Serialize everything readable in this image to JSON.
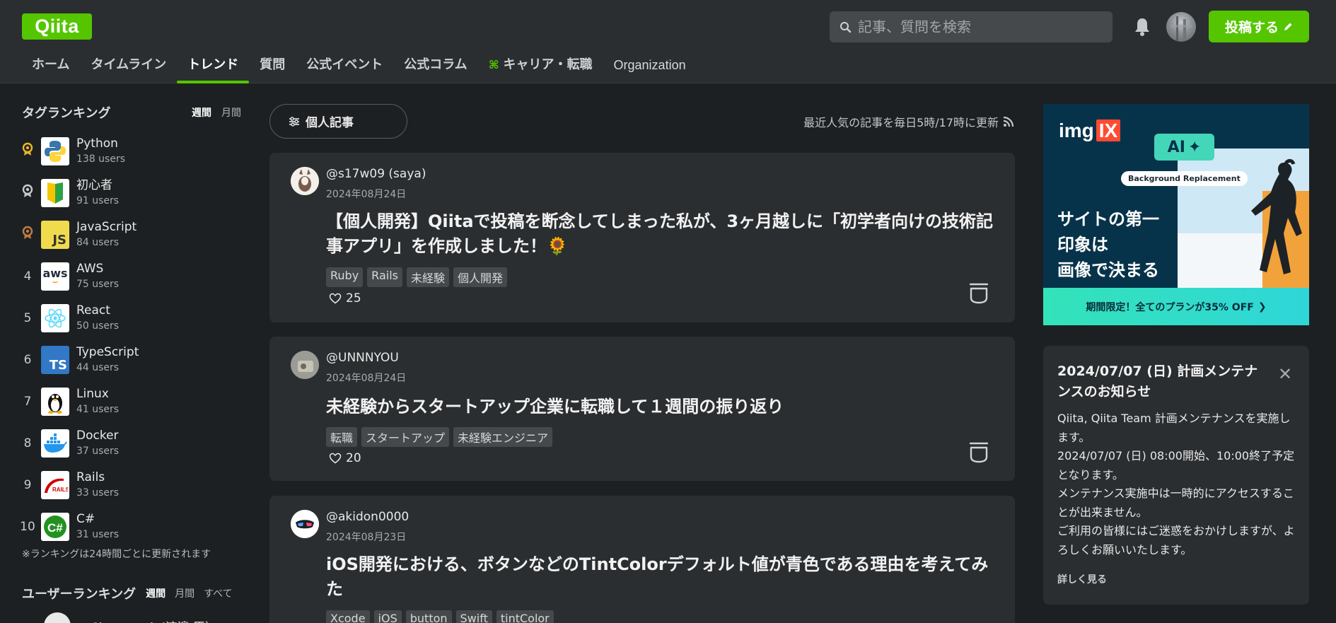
{
  "header": {
    "logo": "Qiita",
    "search_placeholder": "記事、質問を検索",
    "post_button": "投稿する"
  },
  "nav": [
    {
      "label": "ホーム",
      "active": false
    },
    {
      "label": "タイムライン",
      "active": false
    },
    {
      "label": "トレンド",
      "active": true
    },
    {
      "label": "質問",
      "active": false
    },
    {
      "label": "公式イベント",
      "active": false
    },
    {
      "label": "公式コラム",
      "active": false
    },
    {
      "label": "キャリア・転職",
      "active": false
    },
    {
      "label": "Organization",
      "active": false
    }
  ],
  "tag_ranking": {
    "title": "タグランキング",
    "toggle_weekly": "週間",
    "toggle_monthly": "月間",
    "items": [
      {
        "rank": "1",
        "name": "Python",
        "users": "138 users"
      },
      {
        "rank": "2",
        "name": "初心者",
        "users": "91 users"
      },
      {
        "rank": "3",
        "name": "JavaScript",
        "users": "84 users"
      },
      {
        "rank": "4",
        "name": "AWS",
        "users": "75 users"
      },
      {
        "rank": "5",
        "name": "React",
        "users": "50 users"
      },
      {
        "rank": "6",
        "name": "TypeScript",
        "users": "44 users"
      },
      {
        "rank": "7",
        "name": "Linux",
        "users": "41 users"
      },
      {
        "rank": "8",
        "name": "Docker",
        "users": "37 users"
      },
      {
        "rank": "9",
        "name": "Rails",
        "users": "33 users"
      },
      {
        "rank": "10",
        "name": "C#",
        "users": "31 users"
      }
    ],
    "note": "※ランキングは24時間ごとに更新されます"
  },
  "user_ranking": {
    "title": "ユーザーランキング",
    "toggle_weekly": "週間",
    "toggle_monthly": "月間",
    "toggle_all": "すべて",
    "first_user": "@Sicut_study(渡邉 臣）"
  },
  "feed": {
    "filter_label": "個人記事",
    "update_note": "最近人気の記事を毎日5時/17時に更新",
    "articles": [
      {
        "author": "@s17w09 (saya)",
        "date": "2024年08月24日",
        "title": "【個人開発】Qiitaで投稿を断念してしまった私が、3ヶ月越しに「初学者向けの技術記事アプリ」を作成しました！🌻",
        "tags": [
          "Ruby",
          "Rails",
          "未経験",
          "個人開発"
        ],
        "likes": "25"
      },
      {
        "author": "@UNNNYOU",
        "date": "2024年08月24日",
        "title": "未経験からスタートアップ企業に転職して１週間の振り返り",
        "tags": [
          "転職",
          "スタートアップ",
          "未経験エンジニア"
        ],
        "likes": "20"
      },
      {
        "author": "@akidon0000",
        "date": "2024年08月23日",
        "title": "iOS開発における、ボタンなどのTintColorデフォルト値が青色である理由を考えてみた",
        "tags": [
          "Xcode",
          "iOS",
          "button",
          "Swift",
          "tintColor"
        ],
        "likes": ""
      }
    ]
  },
  "ad": {
    "brand": "img",
    "brand_box": "IX",
    "ai_badge": "AI",
    "pill": "Background Replacement",
    "headline_1": "サイトの第一",
    "headline_2": "印象は",
    "headline_3": "画像で決まる",
    "cta": "期間限定！全てのプランが35% OFF"
  },
  "notice": {
    "title": "2024/07/07 (日) 計画メンテナンスのお知らせ",
    "body_1": "Qiita, Qiita Team 計画メンテナンスを実施します。",
    "body_2": "2024/07/07 (日) 08:00開始、10:00終了予定となります。",
    "body_3": "メンテナンス実施中は一時的にアクセスすることが出来ません。",
    "body_4": "ご利用の皆様にはご迷惑をおかけしますが、よろしくお願いいたします。",
    "more": "詳しく見る"
  },
  "colors": {
    "brand_green": "#55c500",
    "background": "#1d2022",
    "surface": "#2b2e30"
  }
}
